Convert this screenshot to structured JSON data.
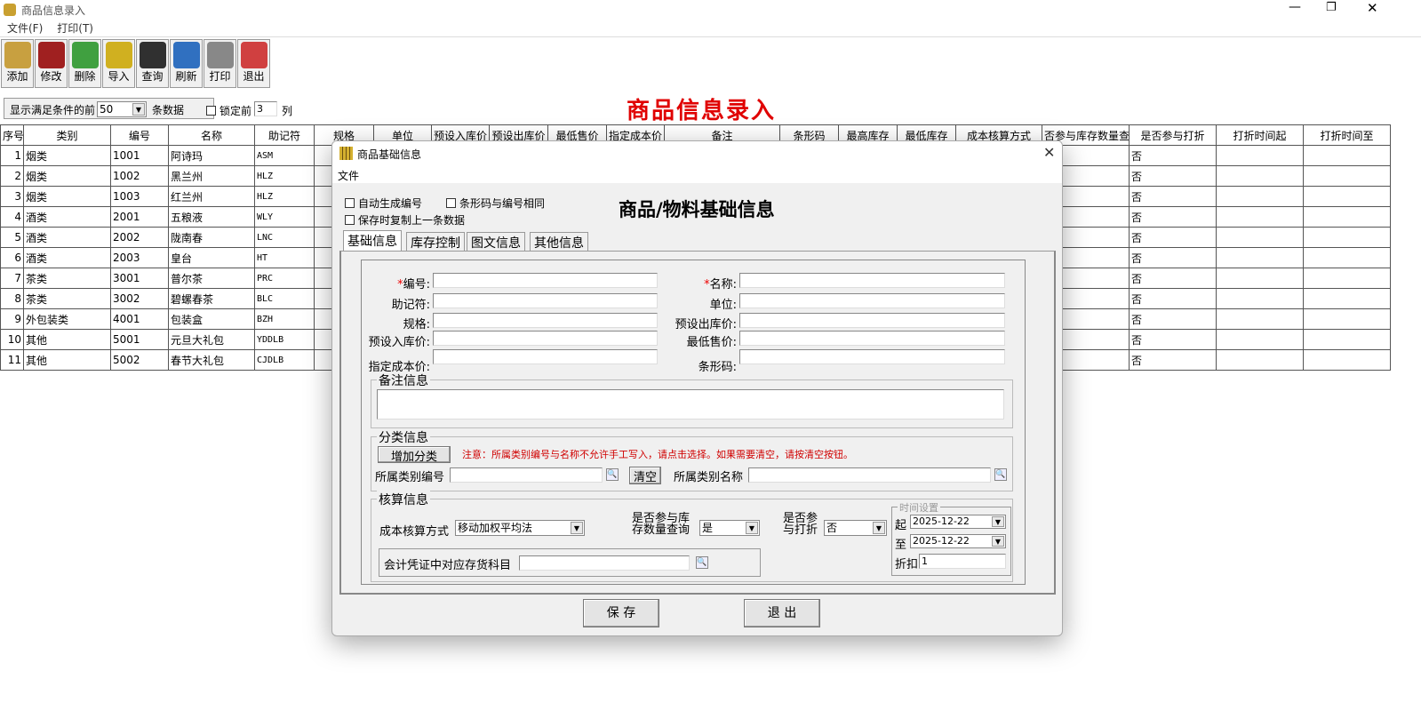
{
  "window": {
    "title": "商品信息录入",
    "controls": [
      "minimize",
      "restore",
      "close"
    ]
  },
  "menu": [
    "文件(F)",
    "打印(T)"
  ],
  "toolbar": [
    {
      "label": "添加",
      "icon": "add-icon",
      "color": "#c8a040"
    },
    {
      "label": "修改",
      "icon": "edit-icon",
      "color": "#a02020"
    },
    {
      "label": "删除",
      "icon": "recycle-icon",
      "color": "#40a040"
    },
    {
      "label": "导入",
      "icon": "gears-icon",
      "color": "#d0b020"
    },
    {
      "label": "查询",
      "icon": "binoculars-icon",
      "color": "#303030"
    },
    {
      "label": "刷新",
      "icon": "brush-icon",
      "color": "#3070c0"
    },
    {
      "label": "打印",
      "icon": "printer-icon",
      "color": "#888888"
    },
    {
      "label": "退出",
      "icon": "exit-icon",
      "color": "#d04040"
    }
  ],
  "filter": {
    "prefix": "显示满足条件的前",
    "count": "50",
    "suffix": "条数据",
    "lock_label": "锁定前",
    "lock_value": "3",
    "lock_suffix": "列"
  },
  "page_title": "商品信息录入",
  "grid": {
    "columns": [
      "序号",
      "类别",
      "编号",
      "名称",
      "助记符",
      "规格",
      "单位",
      "预设入库价",
      "预设出库价",
      "最低售价",
      "指定成本价",
      "备注",
      "条形码",
      "最高库存",
      "最低库存",
      "成本核算方式",
      "否参与库存数量查",
      "是否参与打折",
      "打折时间起",
      "打折时间至"
    ],
    "rows": [
      [
        "1",
        "烟类",
        "1001",
        "阿诗玛",
        "ASM",
        "否"
      ],
      [
        "2",
        "烟类",
        "1002",
        "黑兰州",
        "HLZ",
        "否"
      ],
      [
        "3",
        "烟类",
        "1003",
        "红兰州",
        "HLZ",
        "否"
      ],
      [
        "4",
        "酒类",
        "2001",
        "五粮液",
        "WLY",
        "否"
      ],
      [
        "5",
        "酒类",
        "2002",
        "陇南春",
        "LNC",
        "否"
      ],
      [
        "6",
        "酒类",
        "2003",
        "皇台",
        "HT",
        "否"
      ],
      [
        "7",
        "茶类",
        "3001",
        "普尔茶",
        "PRC",
        "否"
      ],
      [
        "8",
        "茶类",
        "3002",
        "碧螺春茶",
        "BLC",
        "否"
      ],
      [
        "9",
        "外包装类",
        "4001",
        "包装盒",
        "BZH",
        "否"
      ],
      [
        "10",
        "其他",
        "5001",
        "元旦大礼包",
        "YDDLB",
        "否"
      ],
      [
        "11",
        "其他",
        "5002",
        "春节大礼包",
        "CJDLB",
        "否"
      ]
    ]
  },
  "dialog": {
    "title": "商品基础信息",
    "menu": "文件",
    "heading": "商品/物料基础信息",
    "checks": [
      "自动生成编号",
      "条形码与编号相同",
      "保存时复制上一条数据"
    ],
    "tabs": [
      "基础信息",
      "库存控制",
      "图文信息",
      "其他信息"
    ],
    "left_fields": [
      "编号",
      "助记符",
      "规格",
      "预设入库价",
      "指定成本价"
    ],
    "right_fields": [
      "名称",
      "单位",
      "预设出库价",
      "最低售价",
      "条形码"
    ],
    "remark_group": "备注信息",
    "category": {
      "group": "分类信息",
      "add_button": "增加分类",
      "notice": "注意：所属类别编号与名称不允许手工写入，请点击选择。如果需要清空，请按清空按钮。",
      "code_label": "所属类别编号",
      "clear_button": "清空",
      "name_label": "所属类别名称"
    },
    "accounting": {
      "group": "核算信息",
      "method_label": "成本核算方式",
      "method_value": "移动加权平均法",
      "stock_query_label_1": "是否参与库",
      "stock_query_label_2": "存数量查询",
      "stock_query_value": "是",
      "discount_label_1": "是否参",
      "discount_label_2": "与打折",
      "discount_value": "否",
      "voucher_label": "会计凭证中对应存货科目",
      "time": {
        "group": "时间设置",
        "from_label": "起",
        "from_value": "2025-12-22",
        "to_label": "至",
        "to_value": "2025-12-22",
        "discount_rate_label": "折扣",
        "discount_rate_value": "1"
      }
    },
    "save_button": "保 存",
    "exit_button": "退 出"
  }
}
